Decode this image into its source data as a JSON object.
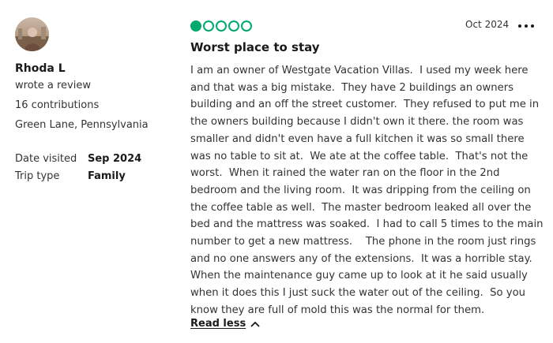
{
  "author": {
    "name": "Rhoda L",
    "action": "wrote a review",
    "contributions": "16 contributions",
    "location": "Green Lane, Pennsylvania",
    "avatar_icon": "user-photo"
  },
  "details": {
    "date_visited_label": "Date visited",
    "date_visited_value": "Sep 2024",
    "trip_type_label": "Trip type",
    "trip_type_value": "Family"
  },
  "review": {
    "rating": 1,
    "rating_max": 5,
    "rating_color": "#00aa6c",
    "date": "Oct 2024",
    "more_icon": "ellipsis-horizontal-icon",
    "title": "Worst place to stay",
    "body_lines": [
      "I am an owner of Westgate Vacation Villas.  I used my week here",
      "and that was a big mistake.  They have 2 buildings an owners",
      "building and an off the street customer.  They refused to put me in",
      "the owners building because I didn't own it there. the room was",
      "smaller and didn't even have a full kitchen it was so small there",
      "was no table to sit at.  We ate at the coffee table.  That's not the",
      "worst.  When it rained the water ran on the floor in the 2nd",
      "bedroom and the living room.  It was dripping from the ceiling on",
      "the coffee table as well.  The master bedroom leaked all over the",
      "bed and the mattress was soaked.  I had to call 5 times to the main",
      "number to get a new mattress.    The phone in the room just rings",
      "and no one answers any of the extensions.  It was a horrible stay.",
      "When the maintenance guy came up to look at it he said usually",
      "when it does this I just suck the water out of the ceiling.  So you",
      "know they are full of mold this was the normal for them."
    ],
    "read_less_label": "Read less",
    "read_less_icon": "chevron-up-icon"
  }
}
